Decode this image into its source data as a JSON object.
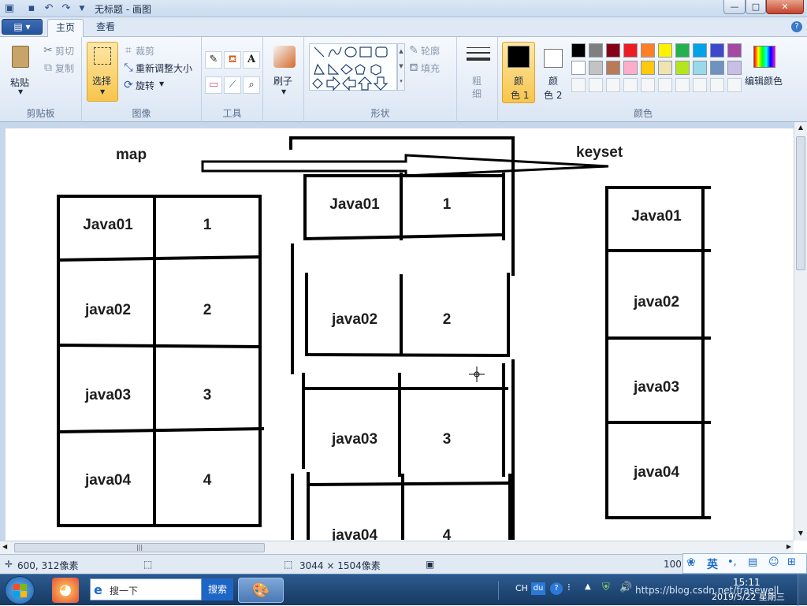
{
  "window": {
    "title": "无标题 - 画图",
    "min_label": "—",
    "max_label": "□",
    "close_label": "✕"
  },
  "tabs": {
    "file_label": "▤ ▾",
    "home": "主页",
    "view": "查看",
    "help": "?"
  },
  "ribbon": {
    "clipboard": {
      "label": "剪贴板",
      "paste": "粘贴",
      "cut": "剪切",
      "copy": "复制"
    },
    "image": {
      "label": "图像",
      "select": "选择",
      "crop": "裁剪",
      "resize": "重新调整大小",
      "rotate": "旋转"
    },
    "tools": {
      "label": "工具"
    },
    "brush": {
      "label": "刷子"
    },
    "shapes": {
      "label": "形状",
      "outline": "轮廓",
      "fill": "填充"
    },
    "size": {
      "label_top": "粗",
      "label_bottom": "细"
    },
    "color1": {
      "label_top": "颜",
      "label_bottom": "色 1"
    },
    "color2": {
      "label_top": "颜",
      "label_bottom": "色 2"
    },
    "colors": {
      "label": "颜色",
      "edit": "编辑颜色",
      "palette_row1": [
        "#000000",
        "#7f7f7f",
        "#880015",
        "#ed1c24",
        "#ff7f27",
        "#fff200",
        "#22b14c",
        "#00a2e8",
        "#3f48cc",
        "#a349a4"
      ],
      "palette_row2": [
        "#ffffff",
        "#c3c3c3",
        "#b97a57",
        "#ffaec9",
        "#ffc90e",
        "#efe4b0",
        "#b5e61d",
        "#99d9ea",
        "#7092be",
        "#c8bfe7"
      ]
    }
  },
  "drawing": {
    "map_label": "map",
    "keyset_label": "keyset",
    "left_table": [
      {
        "key": "Java01",
        "value": "1"
      },
      {
        "key": "java02",
        "value": "2"
      },
      {
        "key": "java03",
        "value": "3"
      },
      {
        "key": "java04",
        "value": "4"
      }
    ],
    "middle_table": [
      {
        "key": "Java01",
        "value": "1"
      },
      {
        "key": "java02",
        "value": "2"
      },
      {
        "key": "java03",
        "value": "3"
      },
      {
        "key": "java04",
        "value": "4"
      }
    ],
    "right_table": [
      "Java01",
      "java02",
      "java03",
      "java04"
    ]
  },
  "status": {
    "cursor_pos": "600, 312像素",
    "image_size": "3044 × 1504像素",
    "zoom": "100"
  },
  "taskbar": {
    "search_placeholder": "搜一下",
    "search_button": "搜索",
    "tray": [
      "CH",
      "du",
      "?"
    ],
    "time": "15:11",
    "date": "2019/5/22 星期三",
    "watermark": "https://blog.csdn.net/frasewell"
  },
  "ime": {
    "lang": "英"
  }
}
